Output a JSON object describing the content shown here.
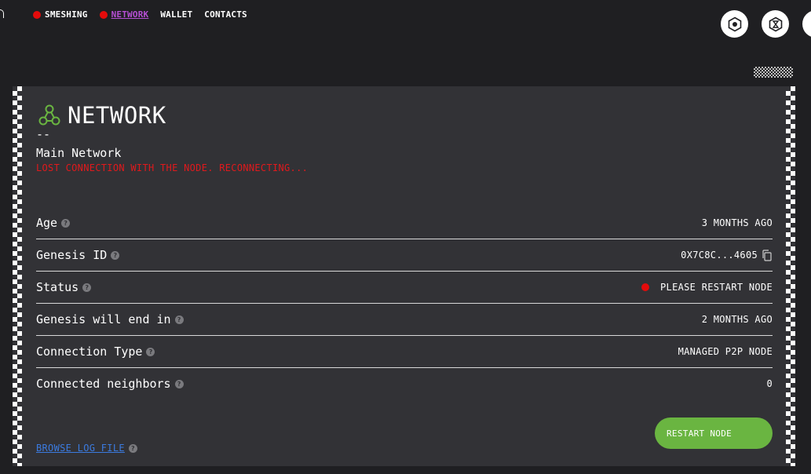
{
  "nav": {
    "items": [
      {
        "label": "SMESHING",
        "has_dot": true,
        "active": false
      },
      {
        "label": "NETWORK",
        "has_dot": true,
        "active": true
      },
      {
        "label": "WALLET",
        "has_dot": false,
        "active": false
      },
      {
        "label": "CONTACTS",
        "has_dot": false,
        "active": false
      }
    ],
    "right_icons": [
      "settings-hex-icon",
      "hourglass-hex-icon",
      "doc-icon"
    ]
  },
  "network": {
    "title": "NETWORK",
    "dash": "--",
    "name": "Main Network",
    "error": "LOST CONNECTION WITH THE NODE. RECONNECTING...",
    "rows": [
      {
        "label": "Age",
        "value": "3 MONTHS AGO"
      },
      {
        "label": "Genesis ID",
        "value": "0X7C8C...4605"
      },
      {
        "label": "Status",
        "value": "PLEASE RESTART NODE"
      },
      {
        "label": "Genesis will end in",
        "value": "2 MONTHS AGO"
      },
      {
        "label": "Connection Type",
        "value": "MANAGED P2P NODE"
      },
      {
        "label": "Connected neighbors",
        "value": "0"
      }
    ],
    "browse_log_label": "BROWSE LOG FILE",
    "restart_label": "RESTART NODE"
  },
  "colors": {
    "background": "#1f1f22",
    "panel": "#323236",
    "accent_green": "#6ab541",
    "error_red": "#e0191c",
    "status_dot": "#e30b0b",
    "active_nav": "#b64fd4",
    "link_blue": "#3b7be0"
  }
}
